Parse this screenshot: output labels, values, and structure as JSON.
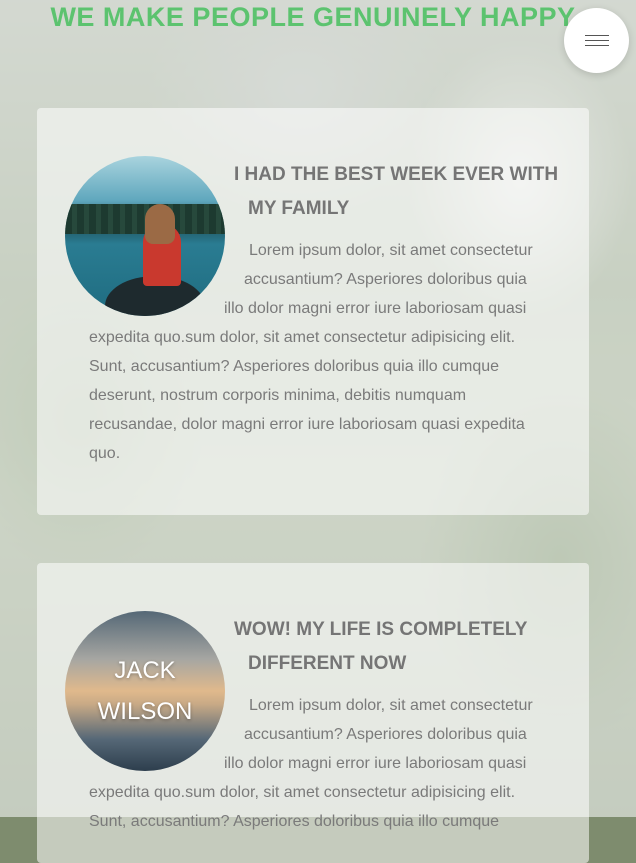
{
  "header": {
    "headline": "WE MAKE PEOPLE GENUINELY HAPPY",
    "menu_icon": "hamburger-icon"
  },
  "testimonials": [
    {
      "title_line1": "I HAD THE BEST WEEK EVER WITH",
      "title_line2": "MY FAMILY",
      "lines": [
        "Lorem ipsum dolor, sit amet consectetur",
        "accusantium? Asperiores doloribus quia",
        "illo dolor magni error iure laboriosam quasi",
        "expedita quo.sum dolor, sit amet consectetur adipisicing elit.",
        "Sunt, accusantium? Asperiores doloribus quia illo cumque",
        "deserunt, nostrum corporis minima, debitis numquam",
        "recusandae, dolor magni error iure laboriosam quasi expedita",
        "quo."
      ]
    },
    {
      "avatar_name_line1": "JACK",
      "avatar_name_line2": "WILSON",
      "title_line1": "WOW! MY LIFE IS COMPLETELY",
      "title_line2": "DIFFERENT NOW",
      "lines": [
        "Lorem ipsum dolor, sit amet consectetur",
        "accusantium? Asperiores doloribus quia",
        "illo dolor magni error iure laboriosam quasi",
        "expedita quo.sum dolor, sit amet consectetur adipisicing elit.",
        "Sunt, accusantium? Asperiores doloribus quia illo cumque"
      ]
    }
  ],
  "colors": {
    "headline": "#5cc36f",
    "title": "#757575",
    "body": "#7a7a7a"
  }
}
